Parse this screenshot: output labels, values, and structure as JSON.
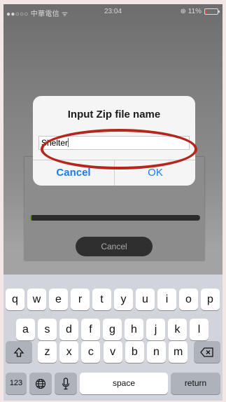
{
  "status_bar": {
    "carrier": "●●○○○ 中華電信 ᯤ",
    "time": "23:04",
    "battery_percent": "⊕ 11%",
    "battery_level": 0.11
  },
  "progress_panel": {
    "progress": 0.01,
    "cancel_label": "Cancel"
  },
  "alert": {
    "title": "Input Zip file name",
    "input_value": "Shelter",
    "cancel_label": "Cancel",
    "ok_label": "OK"
  },
  "keyboard": {
    "row1": [
      "q",
      "w",
      "e",
      "r",
      "t",
      "y",
      "u",
      "i",
      "o",
      "p"
    ],
    "row2": [
      "a",
      "s",
      "d",
      "f",
      "g",
      "h",
      "j",
      "k",
      "l"
    ],
    "row3": [
      "z",
      "x",
      "c",
      "v",
      "b",
      "n",
      "m"
    ],
    "numbers_label": "123",
    "space_label": "space",
    "return_label": "return"
  },
  "colors": {
    "accent": "#1a7cf4",
    "highlight": "#b3271c",
    "progress_fill": "#6a8f1e"
  }
}
